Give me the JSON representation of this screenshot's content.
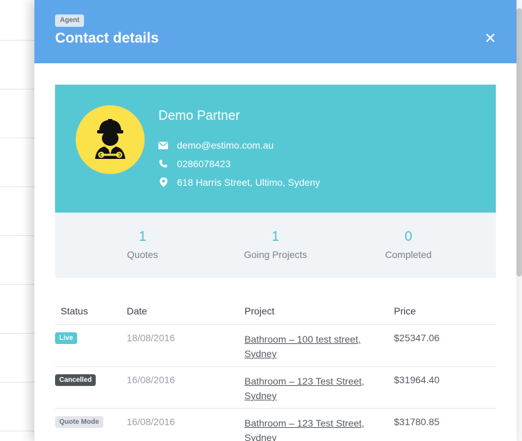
{
  "header": {
    "badge": "Agent",
    "title": "Contact details"
  },
  "profile": {
    "name": "Demo Partner",
    "email": "demo@estimo.com.au",
    "phone": "0286078423",
    "address": "618 Harris Street, Ultimo, Sydeny"
  },
  "stats": [
    {
      "value": "1",
      "label": "Quotes"
    },
    {
      "value": "1",
      "label": "Going Projects"
    },
    {
      "value": "0",
      "label": "Completed"
    }
  ],
  "table": {
    "columns": [
      "Status",
      "Date",
      "Project",
      "Price"
    ],
    "rows": [
      {
        "status": "Live",
        "date": "18/08/2016",
        "project_line1": "Bathroom – 100 test street,",
        "project_line2": "Sydney",
        "price": "$25347.06"
      },
      {
        "status": "Cancelled",
        "date": "16/08/2016",
        "project_line1": "Bathroom – 123 Test Street,",
        "project_line2": "Sydney",
        "price": "$31964.40"
      },
      {
        "status": "Quote Mode",
        "date": "16/08/2016",
        "project_line1": "Bathroom – 123 Test Street,",
        "project_line2": "Sydney",
        "price": "$31780.85"
      }
    ]
  },
  "colors": {
    "header": "#5ea6ea",
    "profile": "#56c8d4",
    "avatar": "#fbe14a",
    "stat_number": "#4fbfcd"
  },
  "icons": [
    "close-icon",
    "email-icon",
    "phone-icon",
    "location-icon",
    "worker-avatar-icon"
  ]
}
